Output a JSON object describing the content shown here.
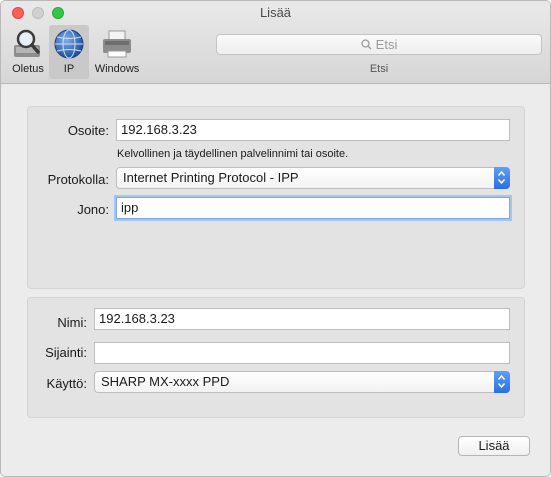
{
  "window": {
    "title": "Lisää"
  },
  "toolbar": {
    "items": [
      {
        "label": "Oletus",
        "icon": "magnifier-printer-icon",
        "selected": false
      },
      {
        "label": "IP",
        "icon": "globe-icon",
        "selected": true
      },
      {
        "label": "Windows",
        "icon": "printer-icon",
        "selected": false
      }
    ],
    "search": {
      "placeholder": "Etsi",
      "caption": "Etsi"
    }
  },
  "connection": {
    "address_label": "Osoite:",
    "address_value": "192.168.3.23",
    "address_hint": "Kelvollinen ja täydellinen palvelinnimi tai osoite.",
    "protocol_label": "Protokolla:",
    "protocol_value": "Internet Printing Protocol - IPP",
    "queue_label": "Jono:",
    "queue_value": "ipp"
  },
  "printer": {
    "name_label": "Nimi:",
    "name_value": "192.168.3.23",
    "location_label": "Sijainti:",
    "location_value": "",
    "use_label": "Käyttö:",
    "use_value": "SHARP MX-xxxx PPD"
  },
  "actions": {
    "add_label": "Lisää"
  },
  "colors": {
    "accent": "#2a6fe0",
    "close": "#fc5f57",
    "maximize": "#33c748"
  }
}
